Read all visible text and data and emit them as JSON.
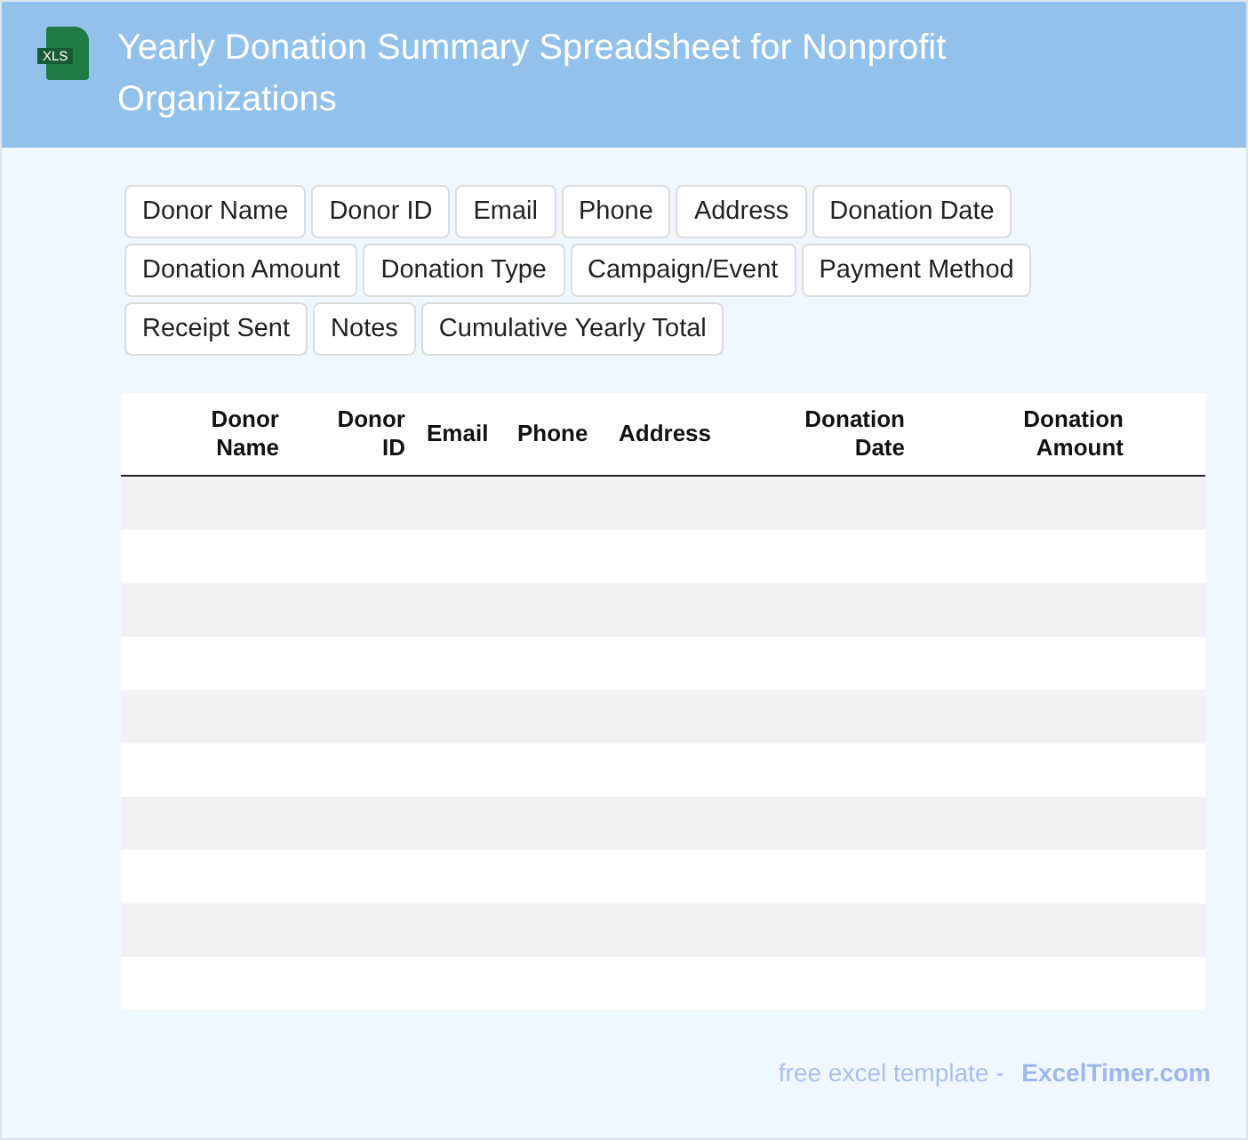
{
  "header": {
    "icon_label": "XLS",
    "title": "Yearly Donation Summary Spreadsheet for Nonprofit Organizations"
  },
  "fields": [
    "Donor Name",
    "Donor ID",
    "Email",
    "Phone",
    "Address",
    "Donation Date",
    "Donation Amount",
    "Donation Type",
    "Campaign/Event",
    "Payment Method",
    "Receipt Sent",
    "Notes",
    "Cumulative Yearly Total"
  ],
  "table": {
    "columns": [
      "Donor Name",
      "Donor ID",
      "Email",
      "Phone",
      "Address",
      "Donation Date",
      "Donation Amount"
    ]
  },
  "footer": {
    "text": "free excel template -",
    "link": "ExcelTimer.com"
  }
}
